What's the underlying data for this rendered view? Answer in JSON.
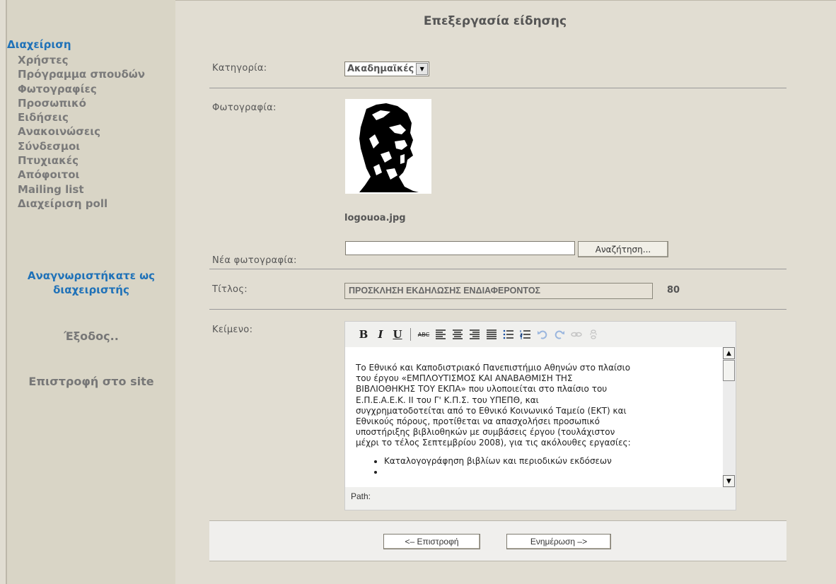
{
  "sidebar": {
    "title": "Διαχείριση",
    "items": [
      {
        "label": "Χρήστες"
      },
      {
        "label": "Πρόγραμμα σπουδών"
      },
      {
        "label": "Φωτογραφίες"
      },
      {
        "label": "Προσωπικό"
      },
      {
        "label": "Ειδήσεις"
      },
      {
        "label": "Ανακοινώσεις"
      },
      {
        "label": "Σύνδεσμοι"
      },
      {
        "label": "Πτυχιακές"
      },
      {
        "label": "Απόφοιτοι"
      },
      {
        "label": "Mailing list"
      },
      {
        "label": "Διαχείριση poll"
      }
    ],
    "logged_in_line1": "Αναγνωριστήκατε ως",
    "logged_in_line2": "διαχειριστής",
    "logout": "Έξοδος..",
    "back_to_site": "Επιστροφή στο site"
  },
  "form": {
    "title": "Επεξεργασία είδησης",
    "category_label": "Κατηγορία:",
    "category_value": "Ακαδημαϊκές",
    "photo_label": "Φωτογραφία:",
    "photo_filename": "logouoa.jpg",
    "new_photo_label": "Νέα φωτογραφία:",
    "browse_button": "Αναζήτηση...",
    "title_label": "Τίτλος:",
    "title_value": "ΠΡΟΣΚΛΗΣΗ ΕΚΔΗΛΩΣΗΣ ΕΝΔΙΑΦΕΡΟΝΤΟΣ",
    "title_count": "80",
    "text_label": "Κείμενο:"
  },
  "editor": {
    "toolbar": {
      "bold": "B",
      "italic": "I",
      "underline": "U",
      "strike": "ABC",
      "icons": [
        "bold-icon",
        "italic-icon",
        "underline-icon",
        "strikethrough-icon",
        "align-left-icon",
        "align-center-icon",
        "align-right-icon",
        "align-justify-icon",
        "bullet-list-icon",
        "numbered-list-icon",
        "undo-icon",
        "redo-icon",
        "link-icon",
        "unlink-icon"
      ]
    },
    "content_lines": [
      "Το Εθνικό και Καποδιστριακό Πανεπιστήμιο Αθηνών στο πλαίσιο",
      "του έργου «ΕΜΠΛΟΥΤΙΣΜΟΣ ΚΑΙ ΑΝΑΒΑΘΜΙΣΗ ΤΗΣ",
      "ΒΙΒΛΙΟΘΗΚΗΣ ΤΟΥ ΕΚΠΑ» που υλοποιείται στο πλαίσιο του",
      "Ε.Π.Ε.Α.Ε.Κ. ΙΙ του Γ' Κ.Π.Σ. του ΥΠΕΠΘ, και",
      "συγχρηματοδοτείται από το Εθνικό Κοινωνικό Ταμείο (ΕΚΤ) και",
      "Εθνικούς πόρους, προτίθεται να απασχολήσει προσωπικό",
      "υποστήριξης βιβλιοθηκών με συμβάσεις έργου (τουλάχιστον",
      "μέχρι το τέλος Σεπτεμβρίου 2008), για τις ακόλουθες εργασίες:"
    ],
    "bullets": [
      "Καταλογογράφηση βιβλίων και περιοδικών εκδόσεων"
    ],
    "path_label": "Path:"
  },
  "buttons": {
    "back": "<– Επιστροφή",
    "update": "Ενημέρωση –>"
  }
}
